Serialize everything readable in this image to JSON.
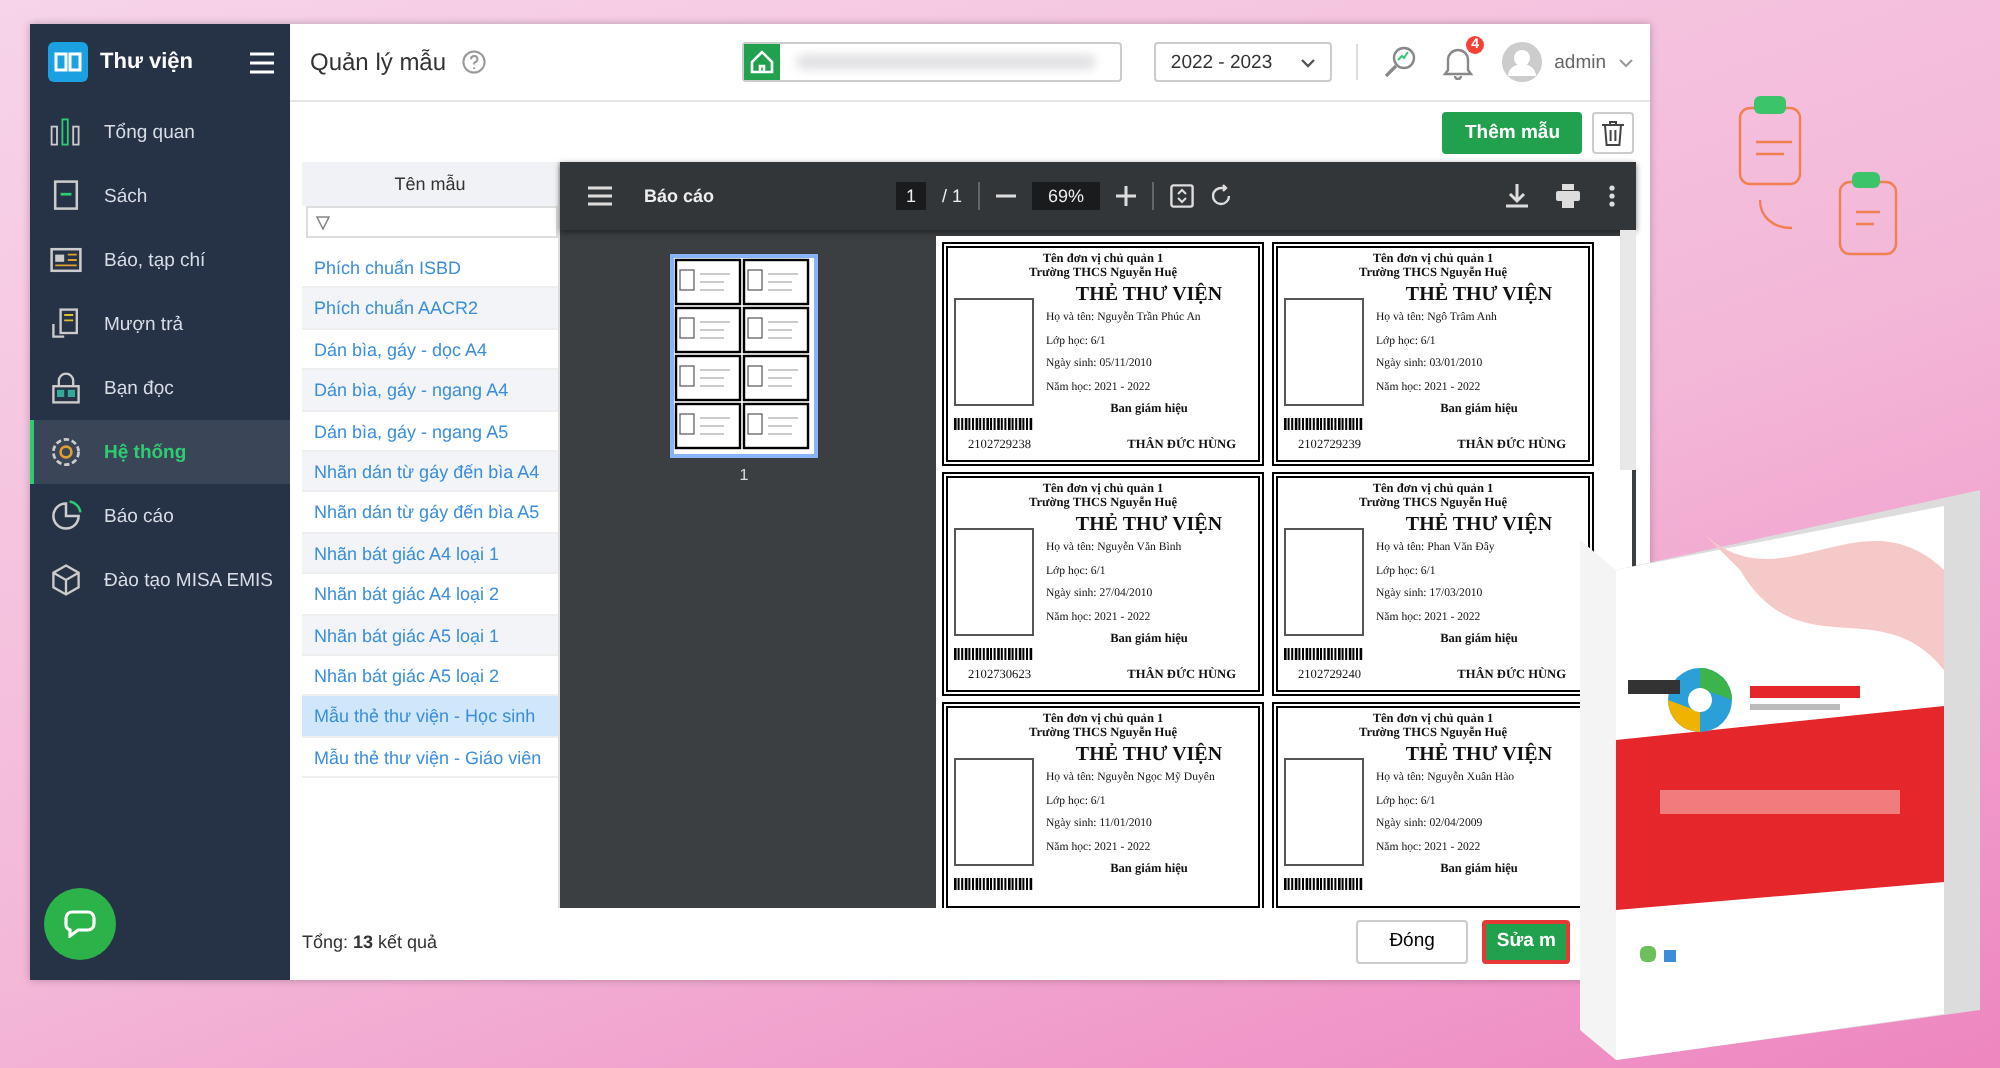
{
  "sidebar": {
    "title": "Thư viện",
    "items": [
      {
        "label": "Tổng quan",
        "selected": false
      },
      {
        "label": "Sách",
        "selected": false
      },
      {
        "label": "Báo, tạp chí",
        "selected": false
      },
      {
        "label": "Mượn trả",
        "selected": false
      },
      {
        "label": "Bạn đọc",
        "selected": false
      },
      {
        "label": "Hệ thống",
        "selected": true
      },
      {
        "label": "Báo cáo",
        "selected": false
      },
      {
        "label": "Đào tạo MISA EMIS",
        "selected": false
      }
    ]
  },
  "header": {
    "title": "Quản lý mẫu",
    "school_year": "2022 - 2023",
    "notification_count": "4",
    "user": "admin"
  },
  "toolbar": {
    "add_button": "Thêm mẫu"
  },
  "template_list": {
    "column": "Tên mẫu",
    "items": [
      {
        "label": "Phích chuẩn ISBD",
        "selected": false
      },
      {
        "label": "Phích chuẩn AACR2",
        "selected": false
      },
      {
        "label": "Dán bìa, gáy - dọc A4",
        "selected": false
      },
      {
        "label": "Dán bìa, gáy - ngang A4",
        "selected": false
      },
      {
        "label": "Dán bìa, gáy - ngang A5",
        "selected": false
      },
      {
        "label": "Nhãn dán từ gáy đến bìa A4",
        "selected": false
      },
      {
        "label": "Nhãn dán từ gáy đến bìa A5",
        "selected": false
      },
      {
        "label": "Nhãn bát giác A4 loại 1",
        "selected": false
      },
      {
        "label": "Nhãn bát giác A4 loại 2",
        "selected": false
      },
      {
        "label": "Nhãn bát giác A5 loại 1",
        "selected": false
      },
      {
        "label": "Nhãn bát giác A5 loại 2",
        "selected": false
      },
      {
        "label": "Mẫu thẻ thư viện - Học sinh",
        "selected": true
      },
      {
        "label": "Mẫu thẻ thư viện - Giáo viên",
        "selected": false
      }
    ]
  },
  "viewer": {
    "title": "Báo cáo",
    "page": "1",
    "page_total": "/ 1",
    "zoom": "69%",
    "thumbnail_label": "1",
    "cards": [
      {
        "unit": "Tên đơn vị chủ quản 1",
        "school": "Trường THCS Nguyễn Huệ",
        "title": "THẺ THƯ VIỆN",
        "name": "Họ và tên: Nguyễn Trần Phúc An",
        "class": "Lớp học: 6/1",
        "birth": "Ngày sinh: 05/11/2010",
        "year": "Năm học: 2021 - 2022",
        "signer_title": "Ban giám hiệu",
        "code": "2102729238",
        "signer": "THÂN ĐỨC HÙNG"
      },
      {
        "unit": "Tên đơn vị chủ quản 1",
        "school": "Trường THCS Nguyễn Huệ",
        "title": "THẺ THƯ VIỆN",
        "name": "Họ và tên: Ngô Trâm Anh",
        "class": "Lớp học: 6/1",
        "birth": "Ngày sinh: 03/01/2010",
        "year": "Năm học: 2021 - 2022",
        "signer_title": "Ban giám hiệu",
        "code": "2102729239",
        "signer": "THÂN ĐỨC HÙNG"
      },
      {
        "unit": "Tên đơn vị chủ quản 1",
        "school": "Trường THCS Nguyễn Huệ",
        "title": "THẺ THƯ VIỆN",
        "name": "Họ và tên: Nguyễn Văn Bình",
        "class": "Lớp học: 6/1",
        "birth": "Ngày sinh: 27/04/2010",
        "year": "Năm học: 2021 - 2022",
        "signer_title": "Ban giám hiệu",
        "code": "2102730623",
        "signer": "THÂN ĐỨC HÙNG"
      },
      {
        "unit": "Tên đơn vị chủ quản 1",
        "school": "Trường THCS Nguyễn Huệ",
        "title": "THẺ THƯ VIỆN",
        "name": "Họ và tên: Phan Văn Đây",
        "class": "Lớp học: 6/1",
        "birth": "Ngày sinh: 17/03/2010",
        "year": "Năm học: 2021 - 2022",
        "signer_title": "Ban giám hiệu",
        "code": "2102729240",
        "signer": "THÂN ĐỨC HÙNG"
      },
      {
        "unit": "Tên đơn vị chủ quản 1",
        "school": "Trường THCS Nguyễn Huệ",
        "title": "THẺ THƯ VIỆN",
        "name": "Họ và tên: Nguyễn Ngọc Mỹ Duyên",
        "class": "Lớp học: 6/1",
        "birth": "Ngày sinh: 11/01/2010",
        "year": "Năm học: 2021 - 2022",
        "signer_title": "Ban giám hiệu"
      },
      {
        "unit": "Tên đơn vị chủ quản 1",
        "school": "Trường THCS Nguyễn Huệ",
        "title": "THẺ THƯ VIỆN",
        "name": "Họ và tên: Nguyễn Xuân Hào",
        "class": "Lớp học: 6/1",
        "birth": "Ngày sinh: 02/04/2009",
        "year": "Năm học: 2021 - 2022",
        "signer_title": "Ban giám hiệu"
      }
    ]
  },
  "footer": {
    "total": "Tổng: **13** kết quả",
    "buttons": [
      "Đóng",
      "Sửa m"
    ]
  }
}
